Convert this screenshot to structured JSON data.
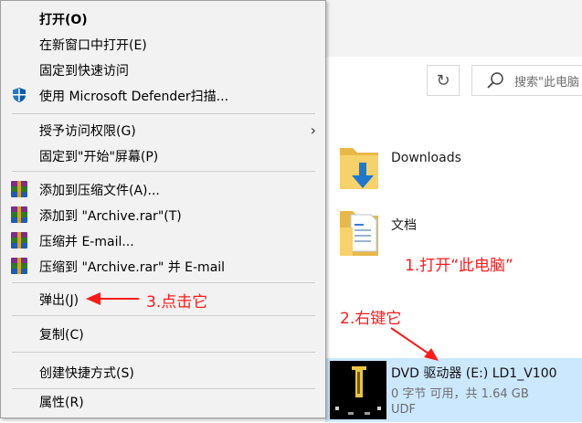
{
  "context_menu": {
    "items": [
      {
        "label": "打开(O)",
        "bold": true,
        "icon": ""
      },
      {
        "label": "在新窗口中打开(E)",
        "icon": ""
      },
      {
        "label": "固定到快速访问",
        "icon": ""
      },
      {
        "label": "使用 Microsoft Defender扫描...",
        "icon": "defender-shield-icon"
      },
      {
        "label": "授予访问权限(G)",
        "icon": "",
        "submenu": true
      },
      {
        "label": "固定到\"开始\"屏幕(P)",
        "icon": ""
      },
      {
        "label": "添加到压缩文件(A)...",
        "icon": "winrar-icon"
      },
      {
        "label": "添加到 \"Archive.rar\"(T)",
        "icon": "winrar-icon"
      },
      {
        "label": "压缩并 E-mail...",
        "icon": "winrar-icon"
      },
      {
        "label": "压缩到 \"Archive.rar\" 并 E-mail",
        "icon": "winrar-icon"
      },
      {
        "label": "弹出(J)",
        "icon": ""
      },
      {
        "label": "复制(C)",
        "icon": ""
      },
      {
        "label": "创建快捷方式(S)",
        "icon": ""
      },
      {
        "label": "属性(R)",
        "icon": ""
      }
    ],
    "submenu_glyph": "›"
  },
  "explorer": {
    "search_placeholder": "搜索\"此电脑",
    "refresh_glyph": "↻",
    "folders": [
      {
        "label": "Downloads",
        "icon": "downloads-folder-icon"
      },
      {
        "label": "文档",
        "icon": "documents-folder-icon"
      }
    ],
    "drive": {
      "name": "DVD 驱动器 (E:) LD1_V100",
      "space": "0 字节 可用，共 1.64 GB",
      "filesystem": "UDF",
      "icon": "dvd-drive-icon"
    }
  },
  "annotations": {
    "step1": "1.打开“此电脑”",
    "step2": "2.右键它",
    "step3": "3.点击它"
  },
  "colors": {
    "annotation": "#ff1a1a",
    "selection": "#cce8ff",
    "menu_bg": "#f2f2f2"
  }
}
